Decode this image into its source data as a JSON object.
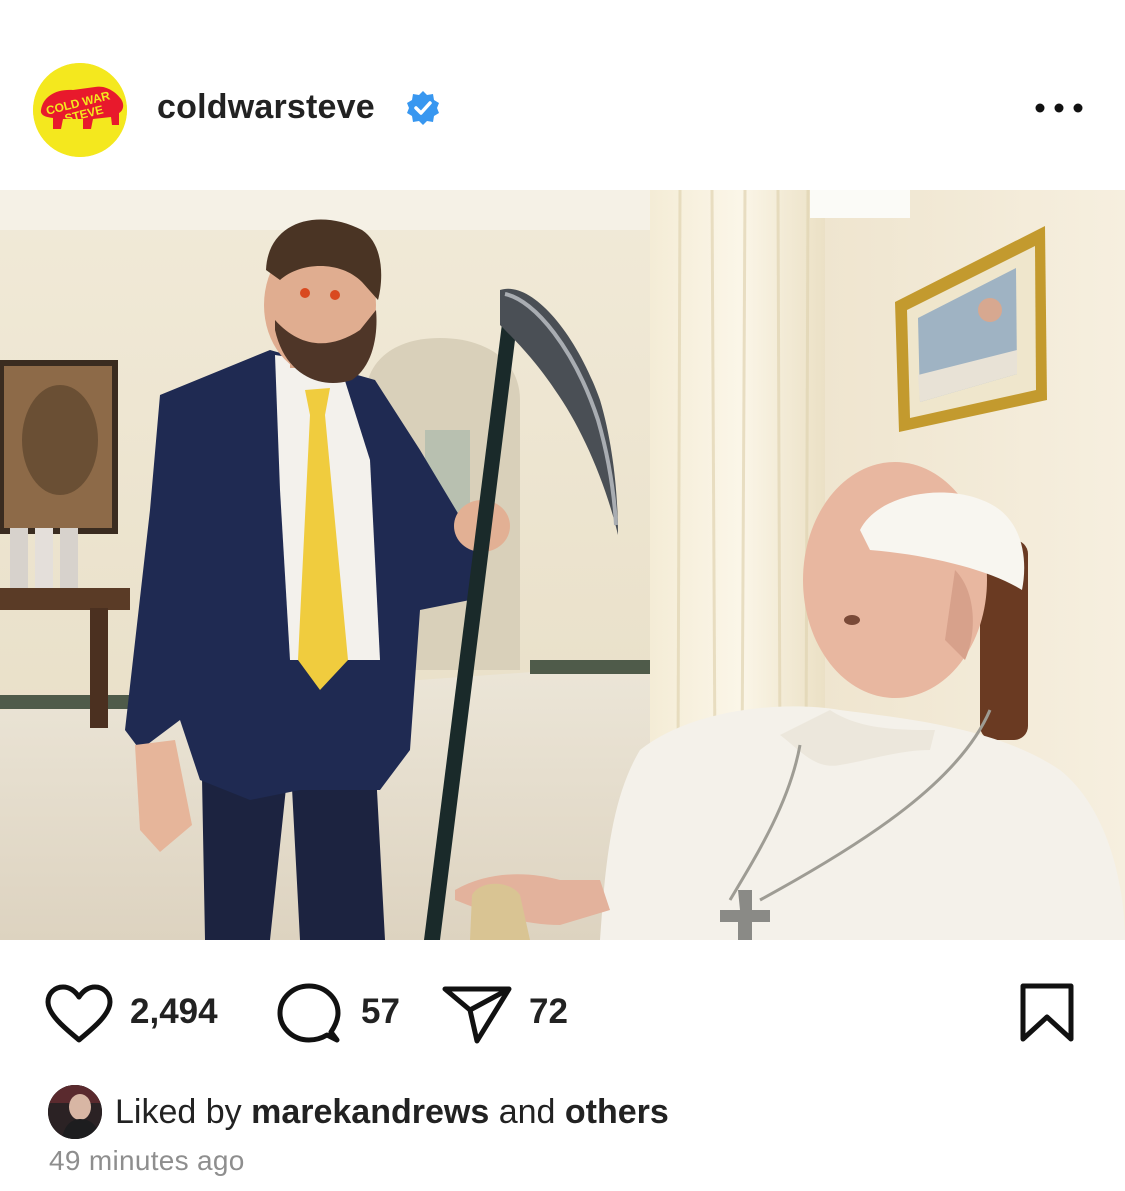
{
  "post": {
    "username": "coldwarsteve",
    "avatar_text": "COLD WAR STEVE",
    "verified_icon": "verified-badge-icon",
    "more_icon": "more-horizontal-icon"
  },
  "actions": {
    "likes": "2,494",
    "comments": "57",
    "shares": "72",
    "like_icon": "heart-icon",
    "comment_icon": "comment-bubble-icon",
    "share_icon": "paper-plane-icon",
    "save_icon": "bookmark-icon"
  },
  "liked_by": {
    "prefix": "Liked by",
    "user": "marekandrews",
    "middle": "and",
    "others": "others"
  },
  "timestamp": "49 minutes ago",
  "colors": {
    "accent_verified": "#3897f0",
    "avatar_bg": "#f4e81e",
    "logo_red": "#e8192c",
    "text_primary": "#222222",
    "text_secondary": "#8e8e8e"
  }
}
